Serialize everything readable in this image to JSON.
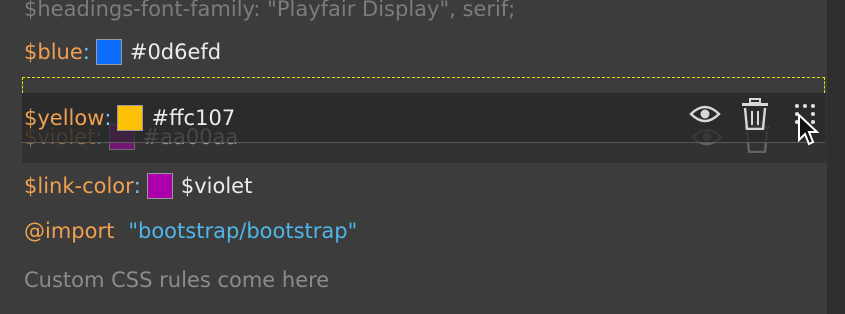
{
  "top_line": {
    "text": "$headings-font-family: \"Playfair Display\", serif;"
  },
  "vars": {
    "blue": {
      "name": "$blue",
      "colon": ":",
      "swatch": "#0d6efd",
      "value": "#0d6efd"
    },
    "yellow": {
      "name": "$yellow",
      "colon": ":",
      "swatch": "#ffc107",
      "value": "#ffc107"
    },
    "violet": {
      "name": "$violet",
      "colon": ":",
      "swatch": "#aa00aa",
      "value": "#aa00aa"
    },
    "link": {
      "name": "$link-color",
      "colon": ":",
      "swatch": "#aa00aa",
      "value": "$violet"
    }
  },
  "import": {
    "keyword": "@import",
    "path": "\"bootstrap/bootstrap\""
  },
  "placeholder": "Custom CSS rules come here",
  "colors": {
    "variable": "#f0a050",
    "colon": "#6ec6ff",
    "string": "#4fb6e8",
    "drop_indicator": "#e6e200",
    "background": "#3c3c3c"
  },
  "icons": {
    "visibility": "eye-icon",
    "delete": "trash-icon",
    "drag": "drag-handle-icon",
    "pointer": "mouse-cursor-icon"
  }
}
